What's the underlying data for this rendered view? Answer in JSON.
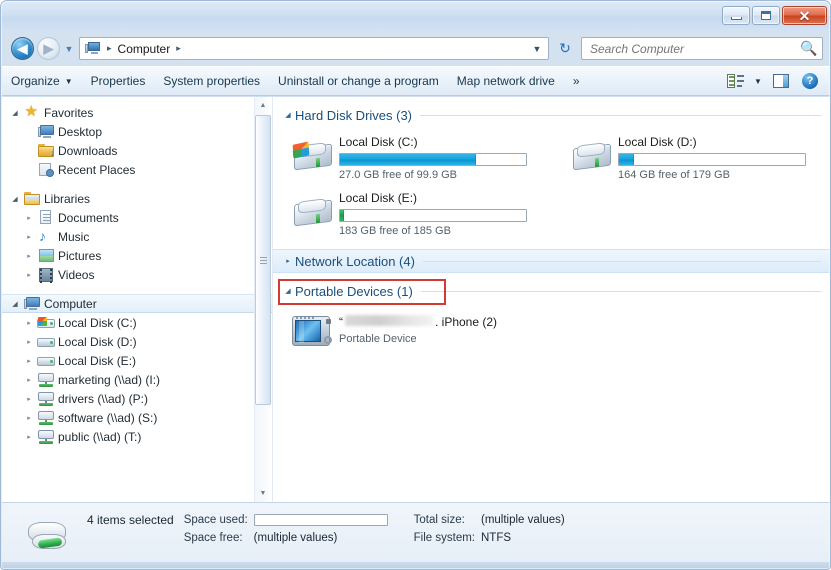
{
  "window": {
    "title": "Computer",
    "buttons": {
      "minimize": "minimize",
      "maximize": "maximize",
      "close": "✕"
    }
  },
  "address_bar": {
    "back_glyph": "◀",
    "forward_glyph": "▶",
    "history_glyph": "▼",
    "root_icon": "computer-icon",
    "crumb": "Computer",
    "separator": "▸",
    "dropdown_glyph": "▼",
    "refresh_glyph": "↻"
  },
  "search": {
    "placeholder": "Search Computer",
    "value": "",
    "icon": "search-icon"
  },
  "toolbar": {
    "items": [
      {
        "label": "Organize",
        "caret": "▼"
      },
      {
        "label": "Properties",
        "caret": ""
      },
      {
        "label": "System properties",
        "caret": ""
      },
      {
        "label": "Uninstall or change a program",
        "caret": ""
      },
      {
        "label": "Map network drive",
        "caret": ""
      },
      {
        "label": "»",
        "caret": ""
      }
    ],
    "view_caret": "▼",
    "help_glyph": "?"
  },
  "sidebar": {
    "groups": [
      {
        "label": "Favorites",
        "icon": "star-icon",
        "expander": "◢",
        "items": [
          {
            "label": "Desktop",
            "icon": "desktop-icon",
            "expander": ""
          },
          {
            "label": "Downloads",
            "icon": "downloads-folder-icon",
            "expander": ""
          },
          {
            "label": "Recent Places",
            "icon": "recent-places-icon",
            "expander": ""
          }
        ]
      },
      {
        "label": "Libraries",
        "icon": "libraries-icon",
        "expander": "◢",
        "items": [
          {
            "label": "Documents",
            "icon": "document-icon",
            "expander": "▸"
          },
          {
            "label": "Music",
            "icon": "music-icon",
            "expander": "▸"
          },
          {
            "label": "Pictures",
            "icon": "picture-icon",
            "expander": "▸"
          },
          {
            "label": "Videos",
            "icon": "video-icon",
            "expander": "▸"
          }
        ]
      },
      {
        "label": "Computer",
        "icon": "computer-icon",
        "expander": "◢",
        "selected": true,
        "items": [
          {
            "label": "Local Disk (C:)",
            "icon": "windows-drive-icon",
            "expander": "▸"
          },
          {
            "label": "Local Disk (D:)",
            "icon": "drive-icon",
            "expander": "▸"
          },
          {
            "label": "Local Disk (E:)",
            "icon": "drive-icon",
            "expander": "▸"
          },
          {
            "label": "marketing (\\\\ad) (I:)",
            "icon": "network-drive-icon",
            "expander": "▸"
          },
          {
            "label": "drivers (\\\\ad) (P:)",
            "icon": "network-drive-icon",
            "expander": "▸"
          },
          {
            "label": "software (\\\\ad) (S:)",
            "icon": "network-drive-icon",
            "expander": "▸"
          },
          {
            "label": "public (\\\\ad) (T:)",
            "icon": "network-drive-icon",
            "expander": "▸"
          }
        ]
      }
    ],
    "scrollbar": {
      "up_glyph": "▲",
      "down_glyph": "▼"
    }
  },
  "content": {
    "groups": [
      {
        "name": "hard-disk-drives",
        "label": "Hard Disk Drives (3)",
        "expander": "◢",
        "expanded": true,
        "drives": [
          {
            "name": "Local Disk (C:)",
            "icon": "windows-drive-icon",
            "usage_text": "27.0 GB free of 99.9 GB",
            "fill_percent": 73,
            "fill_color": "blue"
          },
          {
            "name": "Local Disk (D:)",
            "icon": "drive-icon",
            "usage_text": "164 GB free of 179 GB",
            "fill_percent": 8,
            "fill_color": "blue"
          },
          {
            "name": "Local Disk (E:)",
            "icon": "drive-icon",
            "usage_text": "183 GB free of 185 GB",
            "fill_percent": 2,
            "fill_color": "green"
          }
        ]
      },
      {
        "name": "network-location",
        "label": "Network Location (4)",
        "expander": "▸",
        "expanded": false,
        "drives": []
      },
      {
        "name": "portable-devices",
        "label": "Portable Devices (1)",
        "expander": "◢",
        "expanded": true,
        "highlighted": true,
        "highlight_color": "#d23a32",
        "devices": [
          {
            "name_prefix": "“",
            "name_redacted": true,
            "name_suffix": ". iPhone (2)",
            "subtitle": "Portable Device",
            "icon": "portable-device-icon"
          }
        ]
      }
    ]
  },
  "status_bar": {
    "icon": "drive-icon",
    "selection": "4 items selected",
    "fields": [
      {
        "label": "Space used:",
        "value": "",
        "type": "meter"
      },
      {
        "label": "Total size:",
        "value": "(multiple values)",
        "type": "text"
      },
      {
        "label": "Space free:",
        "value": "(multiple values)",
        "type": "text"
      },
      {
        "label": "File system:",
        "value": "NTFS",
        "type": "text"
      }
    ]
  },
  "colors": {
    "accent_blue": "#1a4f7a",
    "highlight_red": "#d23a32",
    "meter_blue": "#17a5dd",
    "meter_green": "#1f9c4c"
  }
}
